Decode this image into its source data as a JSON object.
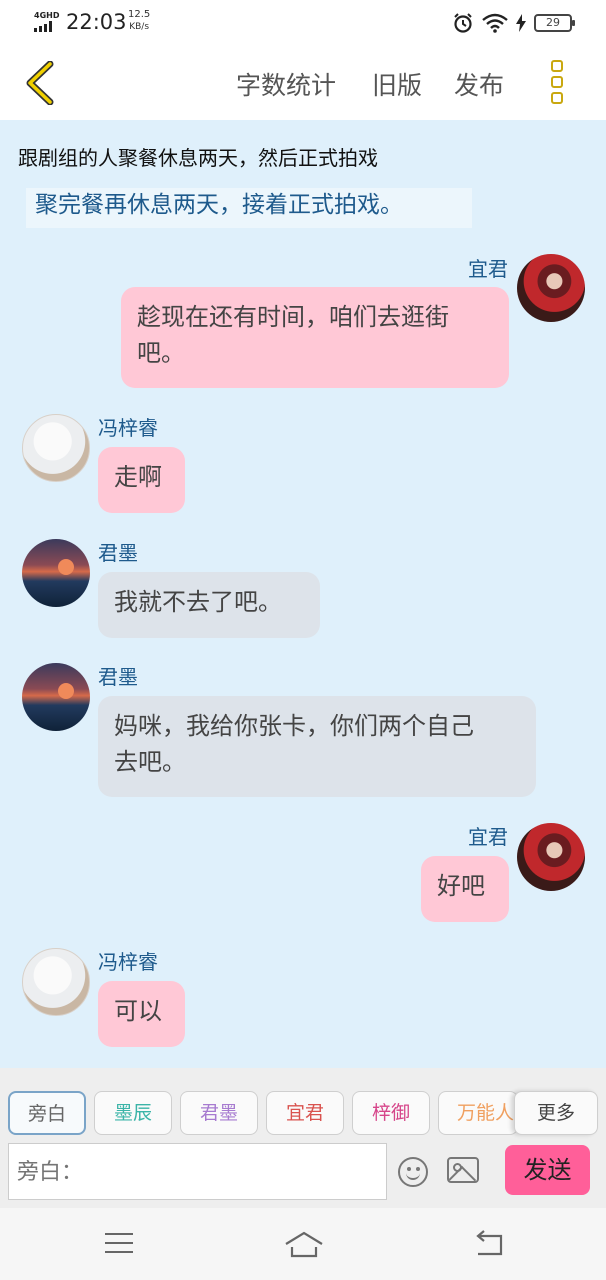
{
  "status_bar": {
    "network": "4GHD",
    "time": "22:03",
    "speed_value": "12.5",
    "speed_unit": "KB/s",
    "battery": "29"
  },
  "header": {
    "word_count": "字数统计",
    "old_version": "旧版",
    "publish": "发布"
  },
  "chat": {
    "narration_1": "跟剧组的人聚餐休息两天，然后正式拍戏",
    "narration_2": "聚完餐再休息两天，接着正式拍戏。",
    "messages": [
      {
        "sender": "宜君",
        "text_lines": [
          "趁现在还有时间，咱们去逛街",
          "吧。"
        ],
        "side": "right"
      },
      {
        "sender": "冯梓睿",
        "text_lines": [
          "走啊"
        ],
        "side": "left"
      },
      {
        "sender": "君墨",
        "text_lines": [
          "我就不去了吧。"
        ],
        "side": "left"
      },
      {
        "sender": "君墨",
        "text_lines": [
          "妈咪，我给你张卡，你们两个自己",
          "去吧。"
        ],
        "side": "left"
      },
      {
        "sender": "宜君",
        "text_lines": [
          "好吧"
        ],
        "side": "right"
      },
      {
        "sender": "冯梓睿",
        "text_lines": [
          "可以"
        ],
        "side": "left"
      }
    ]
  },
  "roles": [
    {
      "label": "旁白",
      "color": "#666666"
    },
    {
      "label": "墨辰",
      "color": "#3bb4a8"
    },
    {
      "label": "君墨",
      "color": "#a77bd0"
    },
    {
      "label": "宜君",
      "color": "#d9534f"
    },
    {
      "label": "梓御",
      "color": "#d6458a"
    },
    {
      "label": "万能人",
      "color": "#f0a060"
    }
  ],
  "more_label": "更多",
  "input": {
    "placeholder": "旁白："
  },
  "send_label": "发送"
}
